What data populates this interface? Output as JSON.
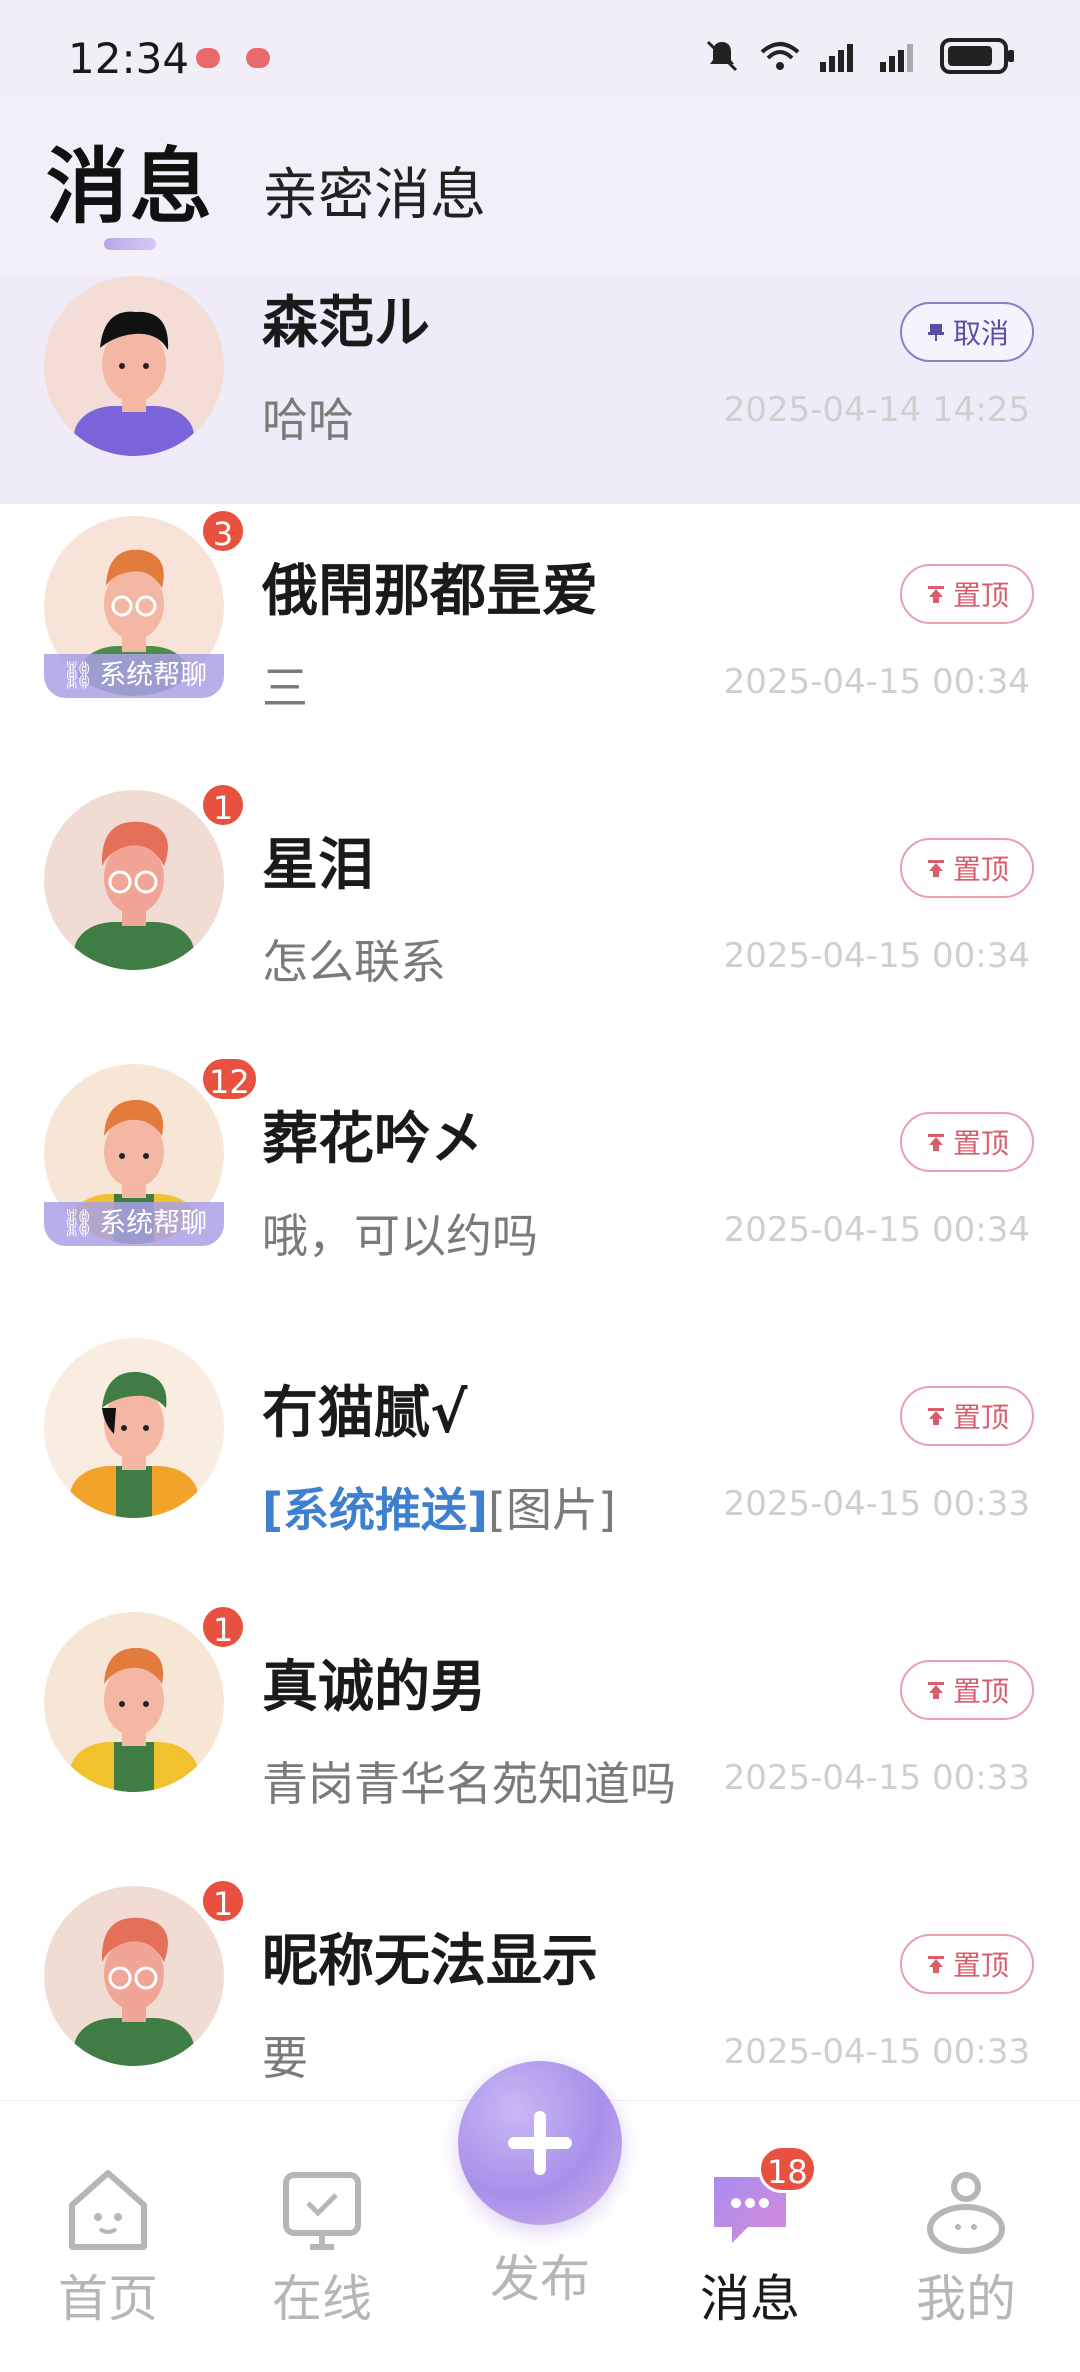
{
  "status_bar": {
    "time": "12:34"
  },
  "header": {
    "tab_main": "消息",
    "tab_secondary": "亲密消息"
  },
  "messages": [
    {
      "name": "森范ル",
      "preview": "哈哈",
      "time": "2025-04-14 14:25",
      "action": "取消",
      "pinned": true,
      "badge": "",
      "helper": ""
    },
    {
      "name": "俄閈那都昰爱",
      "preview": "三",
      "time": "2025-04-15 00:34",
      "action": "置顶",
      "badge": "3",
      "helper": "系统帮聊"
    },
    {
      "name": "星泪",
      "preview": "怎么联系",
      "time": "2025-04-15 00:34",
      "action": "置顶",
      "badge": "1",
      "helper": ""
    },
    {
      "name": "葬花吟㐅",
      "preview": "哦，可以约吗",
      "time": "2025-04-15 00:34",
      "action": "置顶",
      "badge": "12",
      "helper": "系统帮聊"
    },
    {
      "name": "冇猫腻√",
      "preview_sys": "[系统推送]",
      "preview": "[图片]",
      "time": "2025-04-15 00:33",
      "action": "置顶",
      "badge": "",
      "helper": ""
    },
    {
      "name": "真诚的男",
      "preview": "青岗青华名苑知道吗",
      "time": "2025-04-15 00:33",
      "action": "置顶",
      "badge": "1",
      "helper": ""
    },
    {
      "name": "昵称无法显示",
      "preview": "要",
      "time": "2025-04-15 00:33",
      "action": "置顶",
      "badge": "1",
      "helper": ""
    }
  ],
  "bottom_nav": {
    "home": "首页",
    "online": "在线",
    "post": "发布",
    "messages": "消息",
    "messages_badge": "18",
    "mine": "我的"
  },
  "colors": {
    "accent": "#a890ea",
    "badge": "#e8503f",
    "pin": "#d85c6c",
    "system_push": "#3f7fd0"
  }
}
